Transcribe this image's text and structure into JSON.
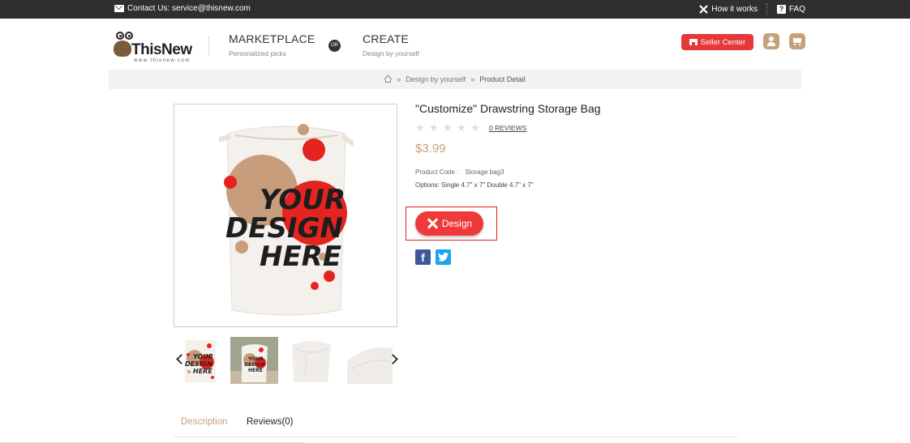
{
  "topbar": {
    "contact": "Contact Us: service@thisnew.com",
    "how_it_works": "How it works",
    "faq": "FAQ"
  },
  "header": {
    "logo_name": "ThisNew",
    "logo_url": "www.thisnew.com",
    "marketplace_title": "MARKETPLACE",
    "marketplace_sub": "Personalized picks",
    "or_label": "OR",
    "create_title": "CREATE",
    "create_sub": "Design by yourself",
    "seller_center": "Seller Center"
  },
  "breadcrumb": {
    "items": [
      "Design by yourself",
      "Product Detail"
    ],
    "separator": "»"
  },
  "product": {
    "title": "\"Customize\" Drawstring Storage Bag",
    "reviews": "0 REVIEWS",
    "rating_stars": 0,
    "price": "$3.99",
    "code_label": "Product Code :",
    "code_value": "Storage bag3",
    "options": "Options:  Single 4.7\" x 7\"   Double 4.7\" x 7\"",
    "design_button": "Design",
    "image_text": [
      "YOUR",
      "DESIGN",
      "HERE"
    ]
  },
  "tabs": {
    "description": "Description",
    "reviews": "Reviews(0)"
  },
  "colors": {
    "accent": "#c8a07c",
    "brand_red": "#f03a3a",
    "topbar": "#2f2f2f"
  }
}
